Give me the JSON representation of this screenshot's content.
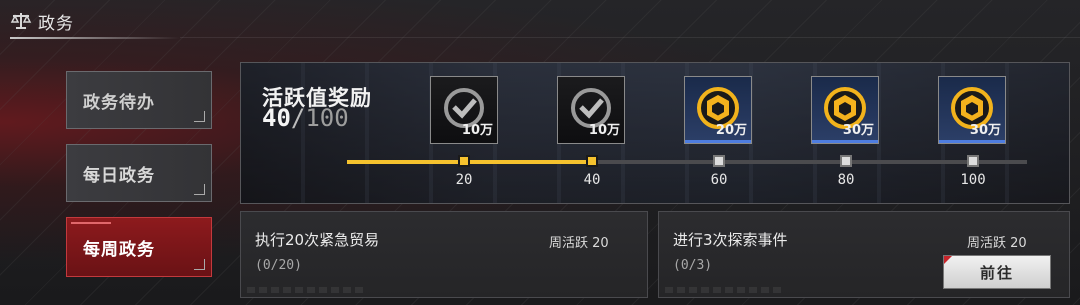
{
  "header": {
    "title": "政务",
    "icon": "scales-icon"
  },
  "sidebar": {
    "items": [
      {
        "label": "政务待办",
        "selected": false
      },
      {
        "label": "每日政务",
        "selected": false
      },
      {
        "label": "每周政务",
        "selected": true
      }
    ]
  },
  "activity": {
    "title": "活跃值奖励",
    "current": "40",
    "separator": "/",
    "max": "100",
    "progress": 0.4,
    "rewards": [
      {
        "amount": "10万",
        "claimed": true,
        "icon": "check-icon"
      },
      {
        "amount": "10万",
        "claimed": true,
        "icon": "check-icon"
      },
      {
        "amount": "20万",
        "claimed": false,
        "icon": "coin-icon"
      },
      {
        "amount": "30万",
        "claimed": false,
        "icon": "coin-icon"
      },
      {
        "amount": "30万",
        "claimed": false,
        "icon": "coin-icon"
      }
    ],
    "milestones": [
      {
        "value": "20",
        "reached": true
      },
      {
        "value": "40",
        "reached": true
      },
      {
        "value": "60",
        "reached": false
      },
      {
        "value": "80",
        "reached": false
      },
      {
        "value": "100",
        "reached": false
      }
    ]
  },
  "tasks": [
    {
      "name": "执行20次紧急贸易",
      "progress": "(0/20)",
      "reward": "周活跃 20"
    },
    {
      "name": "进行3次探索事件",
      "progress": "(0/3)",
      "reward": "周活跃 20",
      "button": "前往"
    }
  ],
  "colors": {
    "accent": "#f5c22e",
    "selected": "#8d1a1d",
    "reward_bar": "#4e7de0"
  }
}
